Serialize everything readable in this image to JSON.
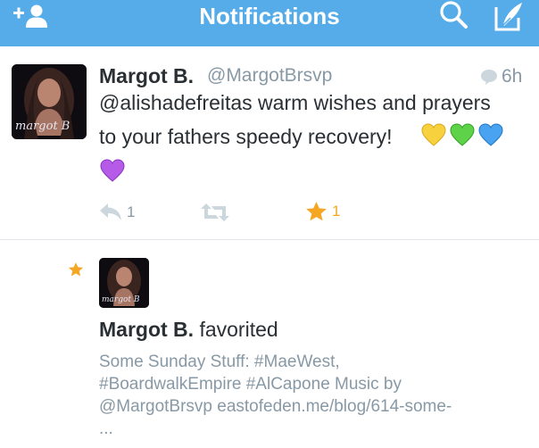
{
  "header": {
    "title": "Notifications",
    "add_user_icon": "add-user-icon",
    "search_icon": "search-icon",
    "compose_icon": "compose-icon",
    "background_color": "#55ace9"
  },
  "tweet": {
    "avatar_signature": "margot B",
    "display_name": "Margot B.",
    "handle": "@MargotBrsvp",
    "time": "6h",
    "text_line1": "@alishadefreitas warm wishes and prayers",
    "text_line2": "to your fathers speedy recovery!",
    "emoji": [
      "yellow-heart",
      "green-heart",
      "blue-heart",
      "purple-heart"
    ],
    "reply_count": "1",
    "retweet_count": "",
    "favorite_count": "1",
    "favorite_color": "#f5a623"
  },
  "activity": {
    "avatar_signature": "margot B",
    "actor_name": "Margot B.",
    "action_text": "favorited",
    "lines": [
      "Some Sunday Stuff: #MaeWest,",
      "#BoardwalkEmpire #AlCapone Music by",
      "@MargotBrsvp eastofeden.me/blog/614-some-",
      "..."
    ]
  }
}
